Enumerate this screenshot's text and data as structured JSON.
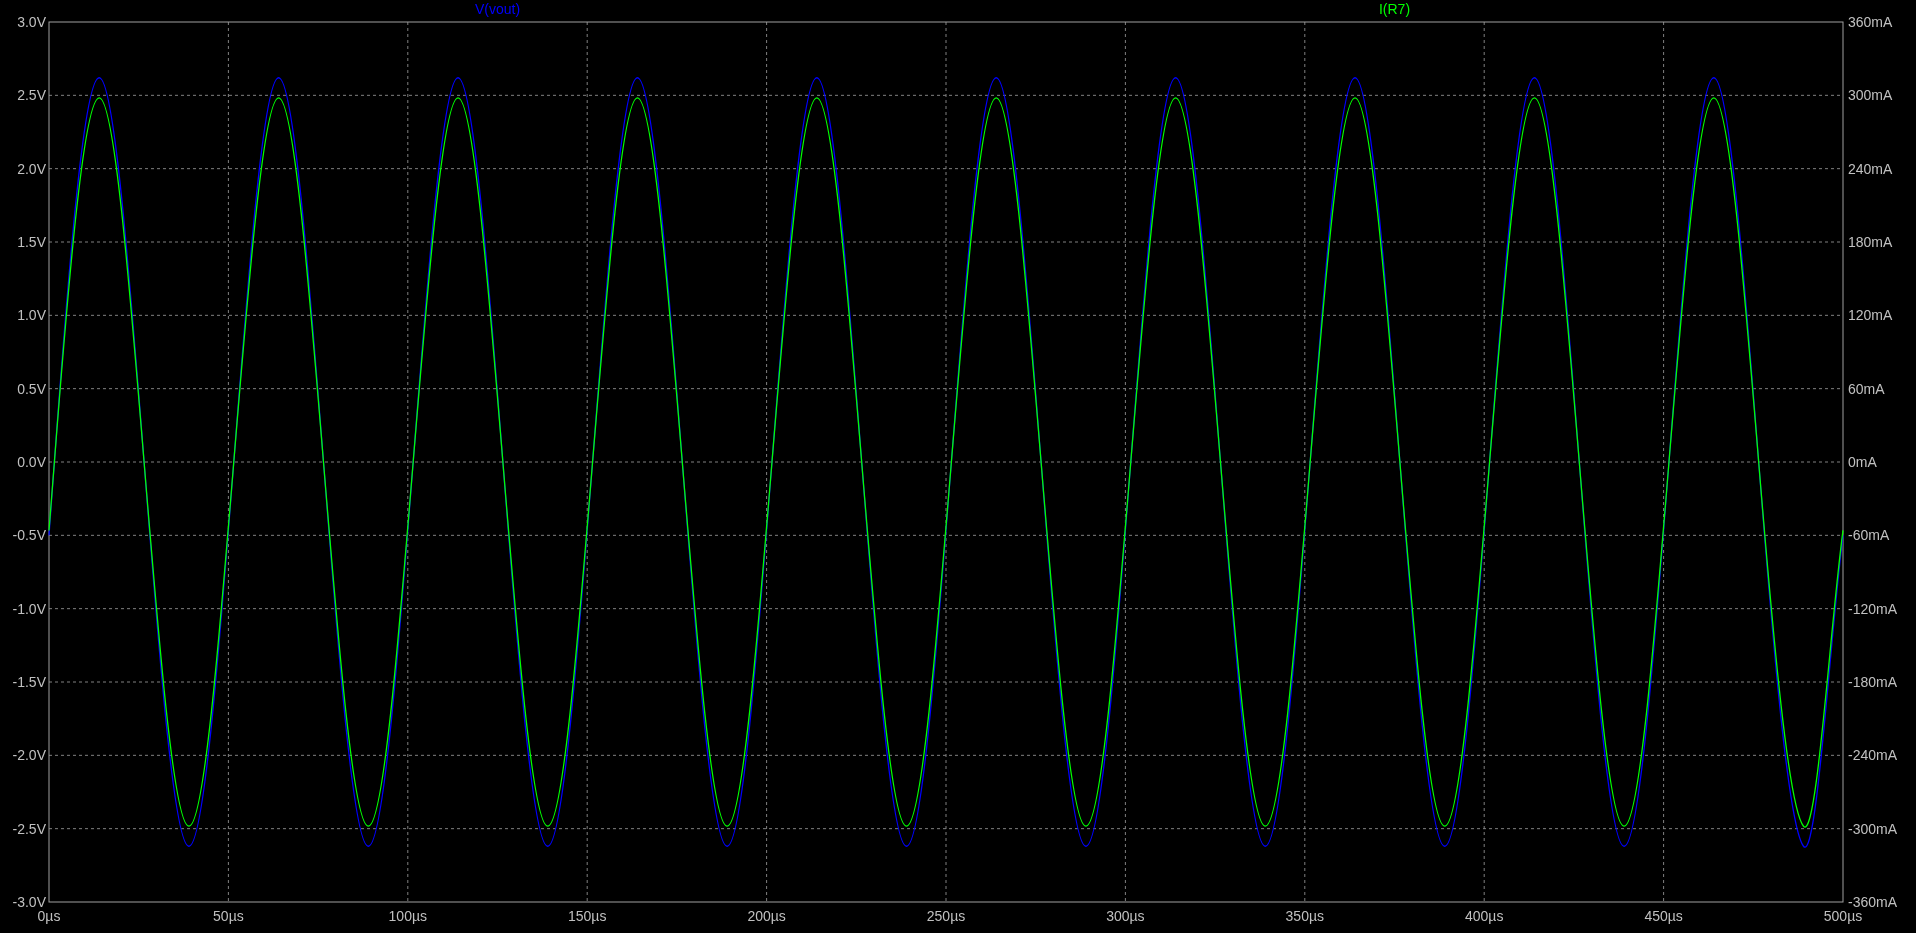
{
  "chart_data": {
    "type": "line",
    "x": [
      0,
      1.5,
      14,
      26.5,
      39,
      51.5,
      64,
      76.5,
      89,
      101.5,
      114,
      126.5,
      139,
      151.5,
      164,
      176.5,
      189,
      201.5,
      214,
      226.5,
      239,
      251.5,
      264,
      276.5,
      289,
      301.5,
      314,
      326.5,
      339,
      351.5,
      364,
      376.5,
      389,
      401.5,
      414,
      426.5,
      439,
      451.5,
      464,
      476.5,
      489,
      500
    ],
    "series": [
      {
        "name": "V(vout)",
        "color": "#0000ff",
        "values": [
          -0.5,
          0,
          2.62,
          0,
          -2.62,
          0,
          2.62,
          0,
          -2.62,
          0,
          2.62,
          0,
          -2.62,
          0,
          2.62,
          0,
          -2.62,
          0,
          2.62,
          0,
          -2.62,
          0,
          2.62,
          0,
          -2.62,
          0,
          2.62,
          0,
          -2.62,
          0,
          2.62,
          0,
          -2.62,
          0,
          2.62,
          0,
          -2.62,
          0,
          2.62,
          0,
          -2.62,
          -0.5
        ]
      },
      {
        "name": "I(R7)",
        "color": "#00ff00",
        "axis": "y2",
        "values": [
          -56,
          0,
          298,
          0,
          -298,
          0,
          298,
          0,
          -298,
          0,
          298,
          0,
          -298,
          0,
          298,
          0,
          -298,
          0,
          298,
          0,
          -298,
          0,
          298,
          0,
          -298,
          0,
          298,
          0,
          -298,
          0,
          298,
          0,
          -298,
          0,
          298,
          0,
          -298,
          0,
          298,
          0,
          -298,
          -56
        ]
      }
    ],
    "grid": true,
    "xlim": [
      0,
      500
    ],
    "ylim": [
      -3,
      3
    ],
    "y2lim": [
      -360,
      360
    ],
    "xticks": [
      {
        "value": 0,
        "label": "0µs"
      },
      {
        "value": 50,
        "label": "50µs"
      },
      {
        "value": 100,
        "label": "100µs"
      },
      {
        "value": 150,
        "label": "150µs"
      },
      {
        "value": 200,
        "label": "200µs"
      },
      {
        "value": 250,
        "label": "250µs"
      },
      {
        "value": 300,
        "label": "300µs"
      },
      {
        "value": 350,
        "label": "350µs"
      },
      {
        "value": 400,
        "label": "400µs"
      },
      {
        "value": 450,
        "label": "450µs"
      },
      {
        "value": 500,
        "label": "500µs"
      }
    ],
    "yticks": [
      {
        "value": 3,
        "label": "3.0V"
      },
      {
        "value": 2.5,
        "label": "2.5V"
      },
      {
        "value": 2,
        "label": "2.0V"
      },
      {
        "value": 1.5,
        "label": "1.5V"
      },
      {
        "value": 1,
        "label": "1.0V"
      },
      {
        "value": 0.5,
        "label": "0.5V"
      },
      {
        "value": 0,
        "label": "0.0V"
      },
      {
        "value": -0.5,
        "label": "-0.5V"
      },
      {
        "value": -1,
        "label": "-1.0V"
      },
      {
        "value": -1.5,
        "label": "-1.5V"
      },
      {
        "value": -2,
        "label": "-2.0V"
      },
      {
        "value": -2.5,
        "label": "-2.5V"
      },
      {
        "value": -3,
        "label": "-3.0V"
      }
    ],
    "y2ticks": [
      {
        "value": 360,
        "label": "360mA"
      },
      {
        "value": 300,
        "label": "300mA"
      },
      {
        "value": 240,
        "label": "240mA"
      },
      {
        "value": 180,
        "label": "180mA"
      },
      {
        "value": 120,
        "label": "120mA"
      },
      {
        "value": 60,
        "label": "60mA"
      },
      {
        "value": 0,
        "label": "0mA"
      },
      {
        "value": -60,
        "label": "-60mA"
      },
      {
        "value": -120,
        "label": "-120mA"
      },
      {
        "value": -180,
        "label": "-180mA"
      },
      {
        "value": -240,
        "label": "-240mA"
      },
      {
        "value": -300,
        "label": "-300mA"
      },
      {
        "value": -360,
        "label": "-360mA"
      }
    ]
  }
}
